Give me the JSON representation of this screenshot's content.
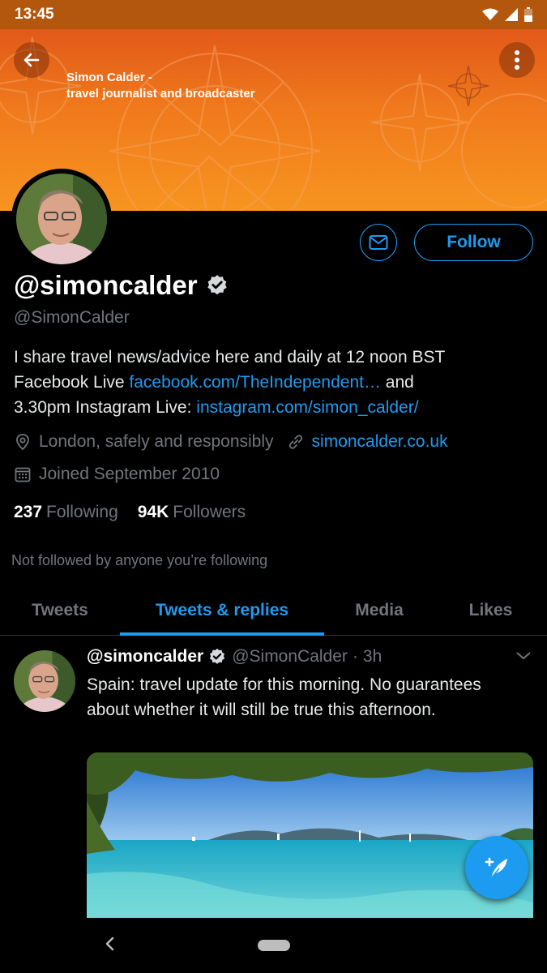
{
  "status_bar": {
    "time": "13:45"
  },
  "banner": {
    "caption_line1": "Simon Calder -",
    "caption_line2": "travel journalist and broadcaster"
  },
  "profile": {
    "display_name": "@simoncalder",
    "handle": "@SimonCalder",
    "follow_label": "Follow",
    "bio_line1": "I share travel news/advice here and daily at 12 noon BST",
    "bio_line2_prefix": "Facebook Live ",
    "bio_link1": "facebook.com/TheIndependent…",
    "bio_line2_suffix": " and",
    "bio_line3_prefix": "3.30pm Instagram Live: ",
    "bio_link2": "instagram.com/simon_calder/",
    "location": "London, safely and responsibly",
    "website": "simoncalder.co.uk",
    "joined": "Joined September 2010",
    "following_count": "237",
    "following_label": "Following",
    "followers_count": "94K",
    "followers_label": "Followers",
    "not_followed": "Not followed by anyone you’re following"
  },
  "tabs": [
    {
      "label": "Tweets"
    },
    {
      "label": "Tweets & replies",
      "active": true
    },
    {
      "label": "Media"
    },
    {
      "label": "Likes"
    }
  ],
  "tweet": {
    "name": "@simoncalder",
    "handle": "@SimonCalder",
    "separator": "·",
    "time": "3h",
    "text": "Spain: travel update for this morning. No guarantees about whether it will still be true this afternoon."
  },
  "colors": {
    "accent": "#1d9bf0",
    "banner_orange": "#f07a1c",
    "status_bar": "#b4570e",
    "muted_text": "#71767b"
  },
  "icons": [
    "back-arrow-icon",
    "more-vertical-icon",
    "mail-icon",
    "verified-badge-icon",
    "location-pin-icon",
    "link-icon",
    "calendar-icon",
    "chevron-down-icon",
    "compose-tweet-icon",
    "wifi-icon",
    "signal-icon",
    "battery-icon",
    "nav-back-icon"
  ]
}
